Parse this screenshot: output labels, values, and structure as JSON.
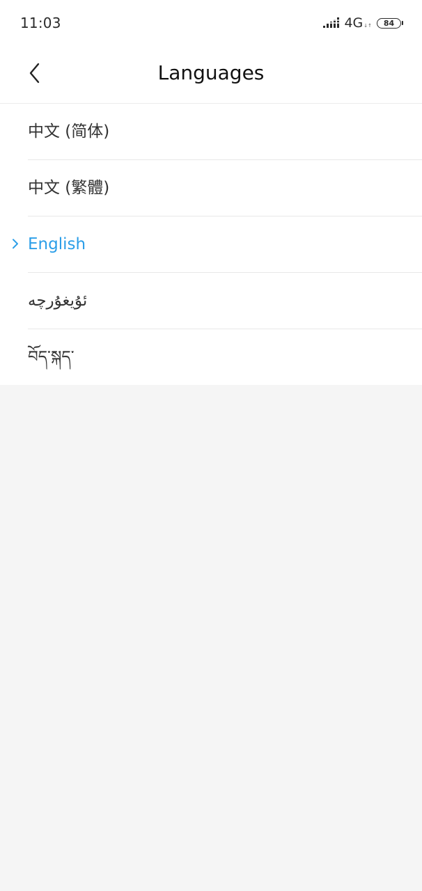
{
  "status_bar": {
    "time": "11:03",
    "network": "4G",
    "network_arrows": "↓↑",
    "battery": "84"
  },
  "header": {
    "title": "Languages",
    "back_icon": "chevron-left-icon"
  },
  "languages": [
    {
      "label": "中文 (简体)",
      "selected": false
    },
    {
      "label": "中文 (繁體)",
      "selected": false
    },
    {
      "label": "English",
      "selected": true
    },
    {
      "label": "ئۇيغۇرچە",
      "selected": false
    },
    {
      "label": "བོད་སྐད་",
      "selected": false
    }
  ],
  "colors": {
    "accent": "#2b9ee8",
    "text": "#333333",
    "background": "#f5f5f5",
    "surface": "#ffffff"
  }
}
